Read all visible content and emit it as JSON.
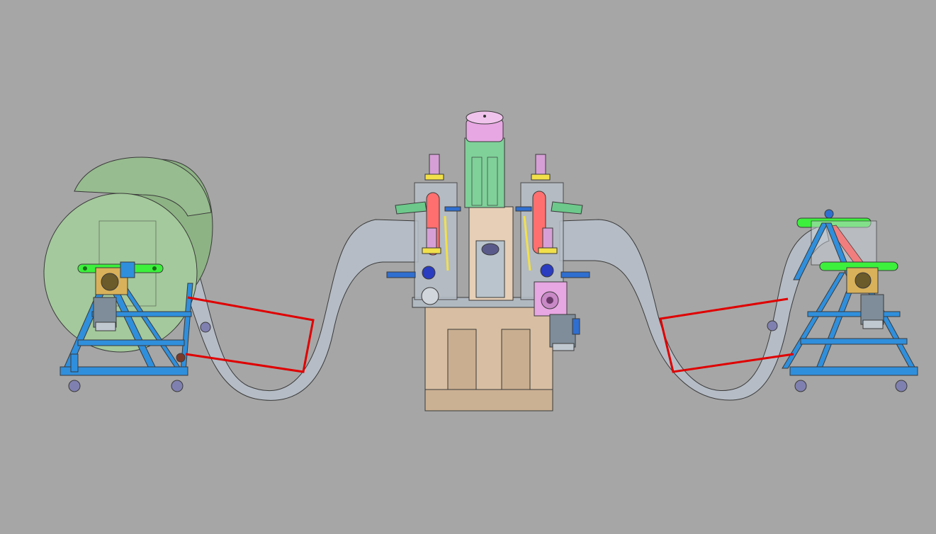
{
  "scene": {
    "background": "#a6a6a6",
    "view": "cad-3d-assembly",
    "colors": {
      "frame": "#2f8fdc",
      "coil": "#9fc497",
      "strip": "#b4bcc6",
      "sensor_line": "#e00000",
      "roller": "#ff6f6f",
      "motor": "#e7a7e2",
      "gearbox_green": "#6cc98b",
      "arm_green": "#3cf03c",
      "base_tan": "#d8bfa3",
      "bracket_yellow": "#f2e04a"
    },
    "components": {
      "left_uncoiler": {
        "icon": "coil-stand",
        "has_coil": true
      },
      "center_machine": {
        "icon": "roller-station"
      },
      "right_recoiler": {
        "icon": "coil-stand",
        "has_coil": false
      }
    }
  }
}
